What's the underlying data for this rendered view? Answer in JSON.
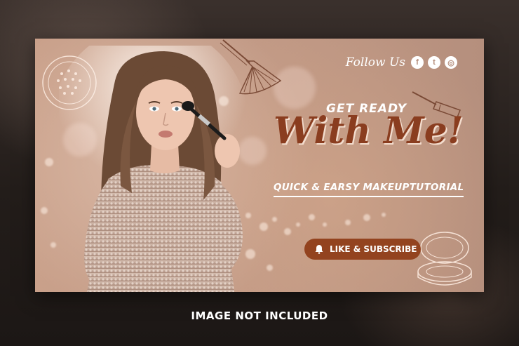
{
  "banner": {
    "follow_label": "Follow Us",
    "social_icons": [
      "facebook-icon",
      "twitter-icon",
      "instagram-icon"
    ],
    "social_glyphs": [
      "f",
      "t",
      "◎"
    ],
    "headline_top": "GET READY",
    "headline_main": "With Me!",
    "subtitle": "QUICK & EARSY MAKEUPTUTORIAL",
    "cta_label": "LIKE & SUBSCRIBE"
  },
  "footer": {
    "notice": "IMAGE NOT INCLUDED"
  },
  "colors": {
    "banner_bg": "#c29a86",
    "accent": "#93431f",
    "headline": "#8a3d1f",
    "text_light": "#ffffff"
  }
}
